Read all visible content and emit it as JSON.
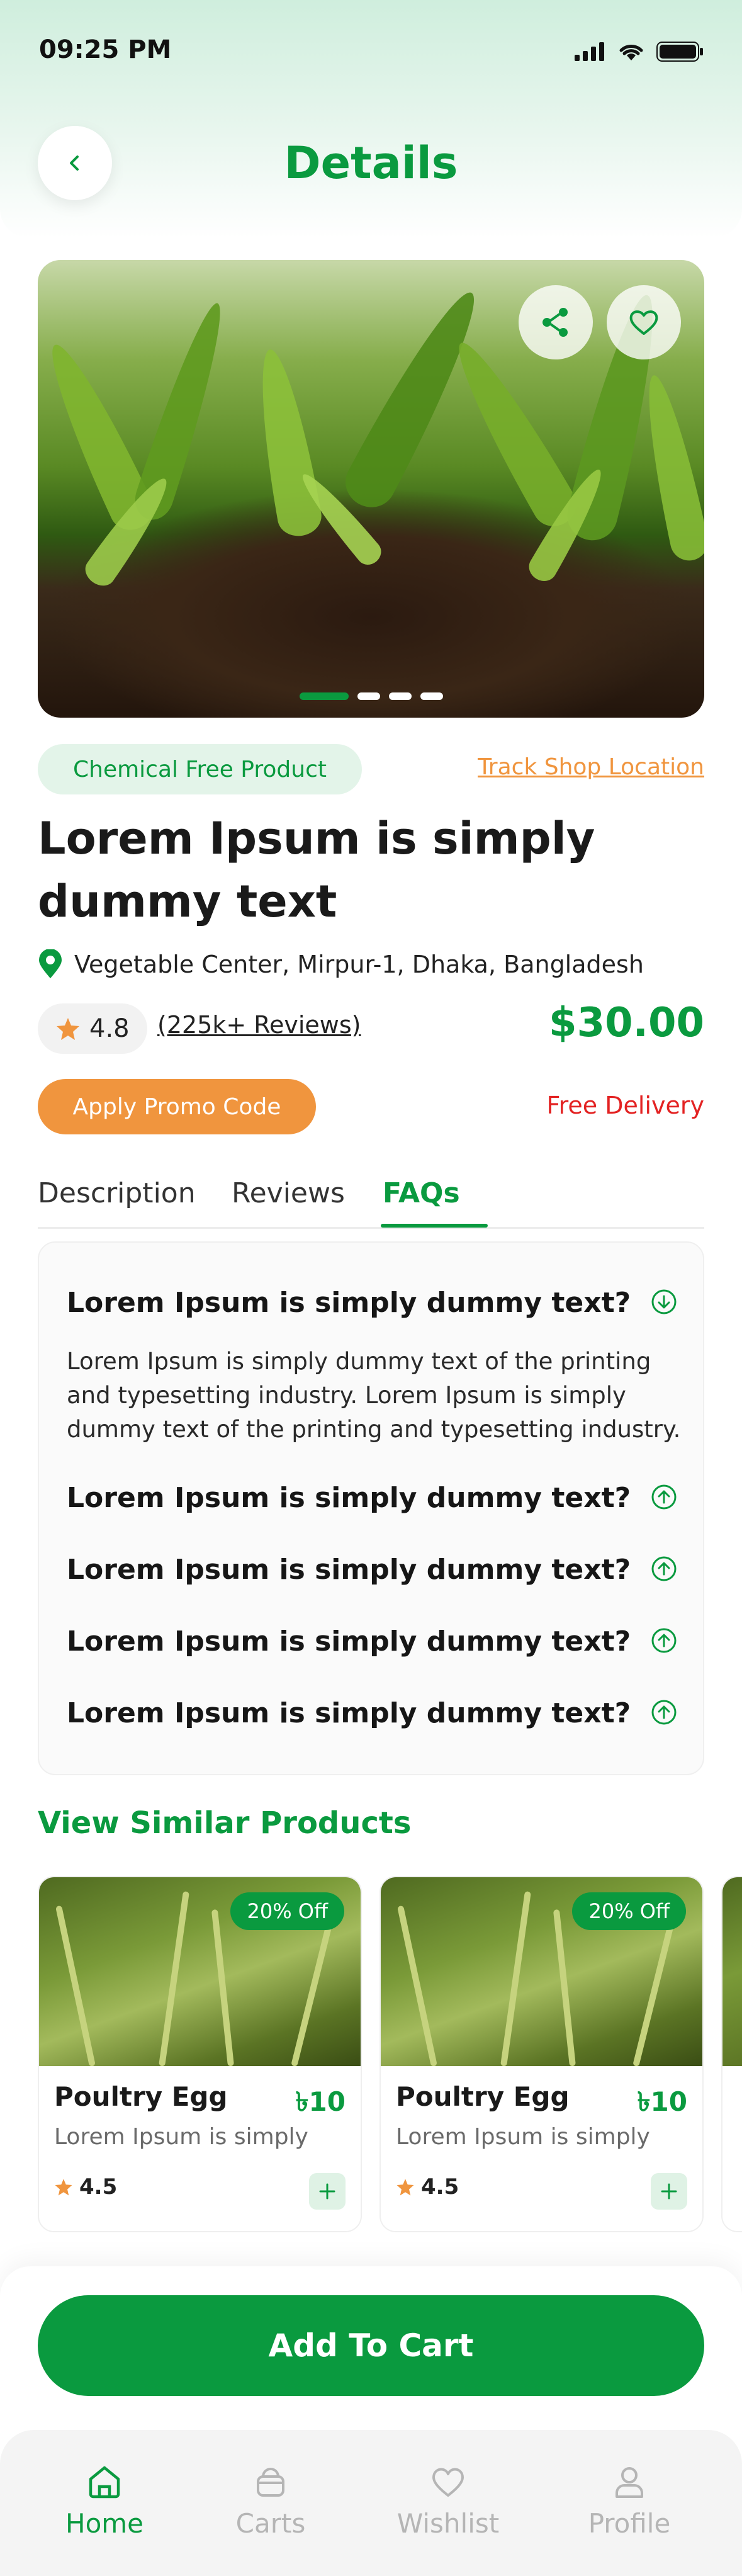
{
  "status_bar": {
    "time": "09:25 PM"
  },
  "header": {
    "title": "Details"
  },
  "hero": {
    "dots": 4,
    "active_dot": 0
  },
  "product": {
    "tag": "Chemical Free Product",
    "track_link": "Track Shop Location",
    "title": "Lorem Ipsum is simply dummy text",
    "location": "Vegetable Center, Mirpur-1, Dhaka, Bangladesh",
    "rating": "4.8",
    "reviews": "(225k+ Reviews)",
    "price": "$30.00",
    "promo_label": "Apply Promo Code",
    "delivery": "Free Delivery"
  },
  "tabs": [
    {
      "label": "Description",
      "active": false
    },
    {
      "label": "Reviews",
      "active": false
    },
    {
      "label": "FAQs",
      "active": true
    }
  ],
  "faqs": [
    {
      "question": "Lorem Ipsum is simply dummy text?",
      "expanded": true,
      "answer": "Lorem Ipsum is simply dummy text of the printing and typesetting industry. Lorem Ipsum is simply dummy text of the printing and typesetting industry."
    },
    {
      "question": "Lorem Ipsum is simply dummy text?",
      "expanded": false
    },
    {
      "question": "Lorem Ipsum is simply dummy text?",
      "expanded": false
    },
    {
      "question": "Lorem Ipsum is simply dummy text?",
      "expanded": false
    },
    {
      "question": "Lorem Ipsum is simply dummy text?",
      "expanded": false
    }
  ],
  "similar": {
    "title": "View Similar Products",
    "items": [
      {
        "badge": "20% Off",
        "name": "Poultry Egg",
        "price": "৳10",
        "desc": "Lorem Ipsum is simply",
        "rating": "4.5"
      },
      {
        "badge": "20% Off",
        "name": "Poultry Egg",
        "price": "৳10",
        "desc": "Lorem Ipsum is simply",
        "rating": "4.5"
      }
    ]
  },
  "cart_button": "Add To Cart",
  "nav": [
    {
      "label": "Home",
      "icon": "home-icon",
      "active": true
    },
    {
      "label": "Carts",
      "icon": "cart-icon",
      "active": false
    },
    {
      "label": "Wishlist",
      "icon": "heart-icon",
      "active": false
    },
    {
      "label": "Profile",
      "icon": "user-icon",
      "active": false
    }
  ],
  "colors": {
    "primary": "#0a9a3f",
    "accent": "#f0953e",
    "danger": "#e32222"
  }
}
